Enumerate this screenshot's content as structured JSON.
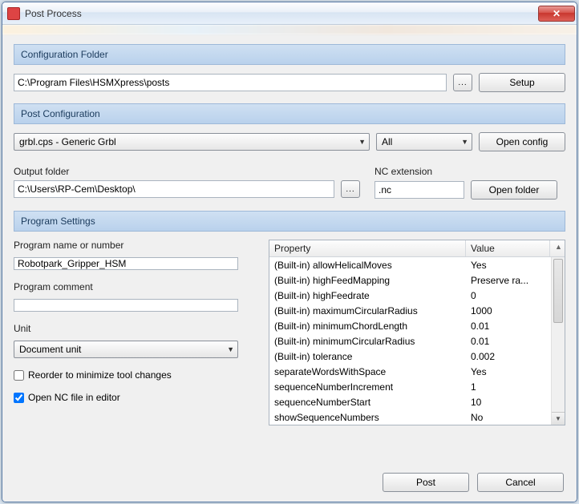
{
  "window": {
    "title": "Post Process"
  },
  "sections": {
    "config_folder": "Configuration Folder",
    "post_config": "Post Configuration",
    "program_settings": "Program Settings"
  },
  "config_folder": {
    "path": "C:\\Program Files\\HSMXpress\\posts",
    "browse": "...",
    "setup": "Setup"
  },
  "post_config": {
    "post_selected": "grbl.cps - Generic Grbl",
    "filter_selected": "All",
    "open_config": "Open config"
  },
  "output": {
    "folder_label": "Output folder",
    "folder_value": "C:\\Users\\RP-Cem\\Desktop\\",
    "browse": "...",
    "ext_label": "NC extension",
    "ext_value": ".nc",
    "open_folder": "Open folder"
  },
  "program": {
    "name_label": "Program name or number",
    "name_value": "Robotpark_Gripper_HSM",
    "comment_label": "Program comment",
    "comment_value": "",
    "unit_label": "Unit",
    "unit_value": "Document unit",
    "reorder_label": "Reorder to minimize tool changes",
    "reorder_checked": false,
    "open_nc_label": "Open NC file in editor",
    "open_nc_checked": true
  },
  "table": {
    "head_prop": "Property",
    "head_val": "Value",
    "rows": [
      {
        "prop": "(Built-in) allowHelicalMoves",
        "val": "Yes"
      },
      {
        "prop": "(Built-in) highFeedMapping",
        "val": "Preserve ra..."
      },
      {
        "prop": "(Built-in) highFeedrate",
        "val": "0"
      },
      {
        "prop": "(Built-in) maximumCircularRadius",
        "val": "1000"
      },
      {
        "prop": "(Built-in) minimumChordLength",
        "val": "0.01"
      },
      {
        "prop": "(Built-in) minimumCircularRadius",
        "val": "0.01"
      },
      {
        "prop": "(Built-in) tolerance",
        "val": "0.002"
      },
      {
        "prop": "separateWordsWithSpace",
        "val": "Yes"
      },
      {
        "prop": "sequenceNumberIncrement",
        "val": "1"
      },
      {
        "prop": "sequenceNumberStart",
        "val": "10"
      },
      {
        "prop": "showSequenceNumbers",
        "val": "No"
      }
    ]
  },
  "footer": {
    "post": "Post",
    "cancel": "Cancel"
  }
}
